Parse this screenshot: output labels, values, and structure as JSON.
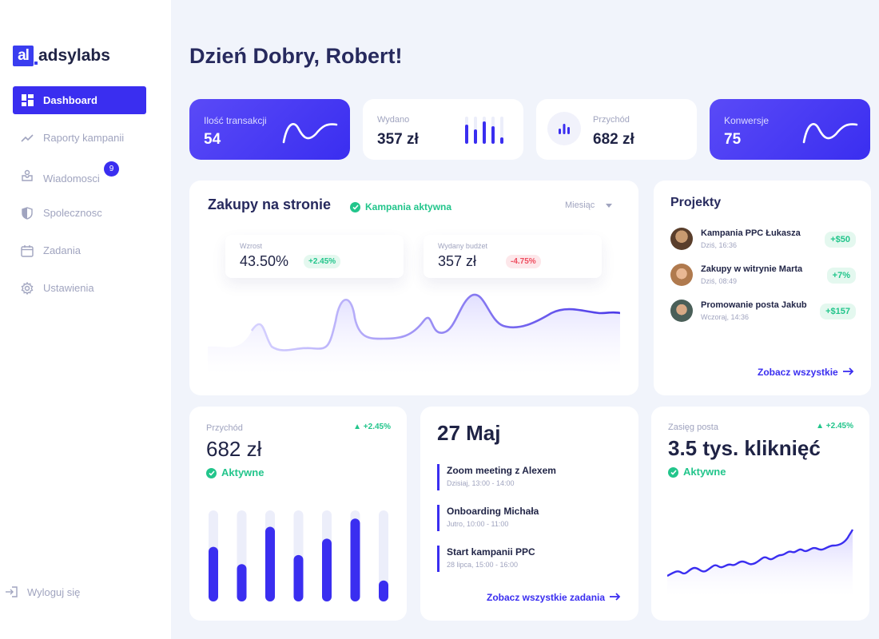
{
  "logo": {
    "mark": "al",
    "text": "adsylabs"
  },
  "sidebar": {
    "items": [
      {
        "label": "Dashboard",
        "icon": "dashboard-icon",
        "active": true
      },
      {
        "label": "Raporty kampanii",
        "icon": "chart-line-icon"
      },
      {
        "label": "Wiadomosci",
        "icon": "inbox-icon",
        "badge": "9"
      },
      {
        "label": "Spolecznosc",
        "icon": "shield-icon"
      },
      {
        "label": "Zadania",
        "icon": "calendar-icon"
      },
      {
        "label": "Ustawienia",
        "icon": "gear-icon"
      }
    ],
    "logout": "Wyloguj się"
  },
  "greeting": "Dzień Dobry, Robert!",
  "stats": [
    {
      "label": "Ilość transakcji",
      "value": "54"
    },
    {
      "label": "Wydano",
      "value": "357 zł"
    },
    {
      "label": "Przychód",
      "value": "682 zł"
    },
    {
      "label": "Konwersje",
      "value": "75"
    }
  ],
  "sales": {
    "title": "Zakupy na stronie",
    "status": "Kampania aktywna",
    "period": "Miesiąc",
    "growth_label": "Wzrost",
    "growth_value": "43.50%",
    "growth_change": "+2.45%",
    "budget_label": "Wydany budżet",
    "budget_value": "357 zł",
    "budget_change": "-4.75%"
  },
  "projects": {
    "title": "Projekty",
    "items": [
      {
        "name": "Kampania PPC Łukasza",
        "time": "Dziś, 16:36",
        "amount": "+$50"
      },
      {
        "name": "Zakupy w witrynie Marta",
        "time": "Dziś, 08:49",
        "amount": "+7%"
      },
      {
        "name": "Promowanie posta Jakub",
        "time": "Wczoraj, 14:36",
        "amount": "+$157"
      }
    ],
    "link": "Zobacz wszystkie"
  },
  "revenue": {
    "label": "Przychód",
    "value": "682 zł",
    "change": "+2.45%",
    "status": "Aktywne",
    "bars": [
      0.6,
      0.41,
      0.82,
      0.51,
      0.69,
      0.91,
      0.23
    ]
  },
  "calendar": {
    "date": "27 Maj",
    "events": [
      {
        "title": "Zoom meeting z Alexem",
        "time": "Dzisiaj, 13:00 - 14:00"
      },
      {
        "title": "Onboarding Michała",
        "time": "Jutro, 10:00 - 11:00"
      },
      {
        "title": "Start kampanii PPC",
        "time": "28 lipca, 15:00 - 16:00"
      }
    ],
    "link": "Zobacz wszystkie zadania"
  },
  "reach": {
    "label": "Zasięg posta",
    "value": "3.5 tys. kliknięć",
    "change": "+2.45%",
    "status": "Aktywne"
  },
  "colors": {
    "accent": "#3a2ef0",
    "green": "#22c58b",
    "red": "#ef4d5f",
    "bg": "#f1f4fb"
  }
}
